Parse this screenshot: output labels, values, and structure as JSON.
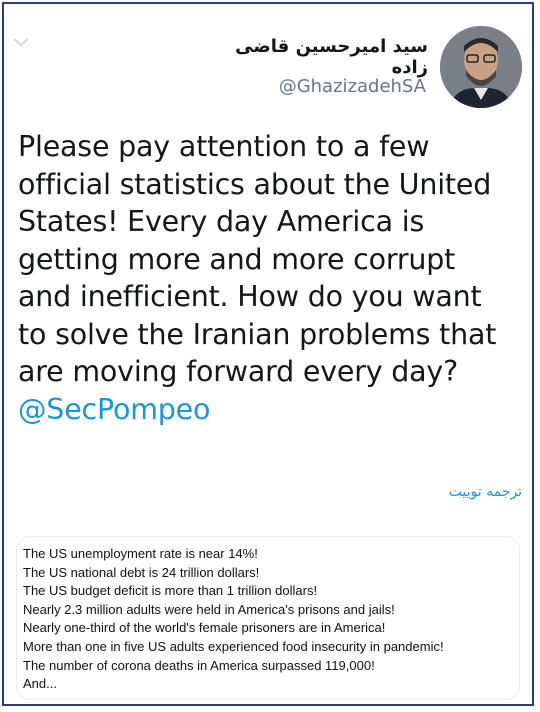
{
  "tweet": {
    "display_name": "سید امیرحسین قاضی زاده",
    "handle": "@GhazizadehSA",
    "text_lines": [
      "Please pay attention to a few",
      "official statistics about the United",
      "States! Every day America is",
      "getting more and more corrupt",
      "and inefficient. How do you want",
      "to solve the Iranian problems that",
      "are moving forward every day?"
    ],
    "mention": "@SecPompeo",
    "translate_label": "ترجمه توییت",
    "icons": {
      "menu": "chevron-down-icon",
      "avatar": "profile-photo"
    }
  },
  "image_card": {
    "lines": [
      "The US unemployment rate is near 14%!",
      "The US national debt is 24 trillion dollars!",
      "The US budget deficit is more than 1 trillion dollars!",
      "Nearly 2.3 million adults were held in America's prisons and jails!",
      "Nearly one-third of the world's female prisoners are in America!",
      "More than one in five US adults experienced food insecurity in pandemic!",
      "The number of corona deaths in America surpassed 119,000!",
      "And..."
    ]
  },
  "colors": {
    "frame_border": "#2b3a8c",
    "link": "#1b95e0",
    "text": "#14171a",
    "secondary": "#657786"
  }
}
